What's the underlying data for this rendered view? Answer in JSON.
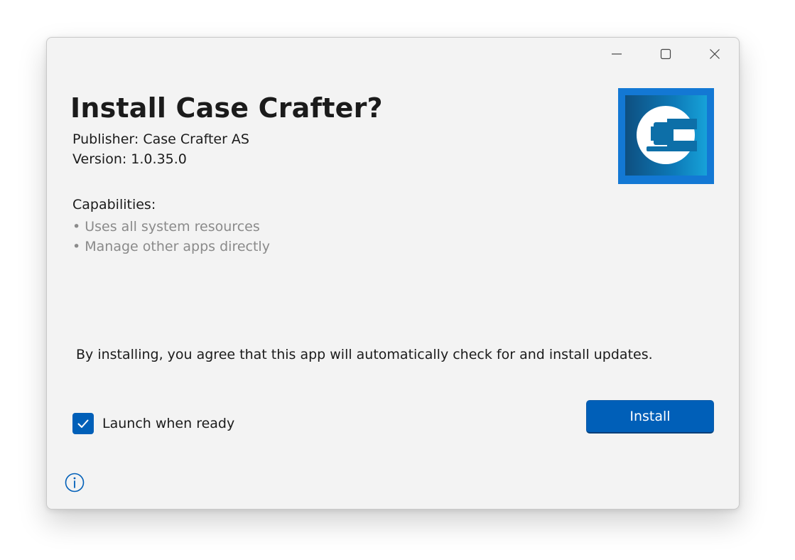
{
  "dialog": {
    "title": "Install Case Crafter?",
    "publisher": "Publisher: Case Crafter AS",
    "version": "Version: 1.0.35.0",
    "capabilities_title": "Capabilities:",
    "capabilities": [
      "• Uses all system resources",
      "• Manage other apps directly"
    ],
    "agreement": "By installing, you agree that this app will automatically check for and install updates.",
    "launch_checkbox": {
      "label": "Launch when ready",
      "checked": true
    },
    "install_button": "Install"
  },
  "titlebar": {
    "buttons": [
      "minimize-icon",
      "maximize-icon",
      "close-icon"
    ]
  },
  "icons": {
    "app_logo": "case-crafter-logo",
    "info": "info-icon",
    "checkmark": "checkmark-icon"
  },
  "colors": {
    "accent": "#005fb8",
    "window_bg": "#f3f3f3",
    "muted_text": "#8a8a8a",
    "logo_frame": "#1378d4"
  }
}
